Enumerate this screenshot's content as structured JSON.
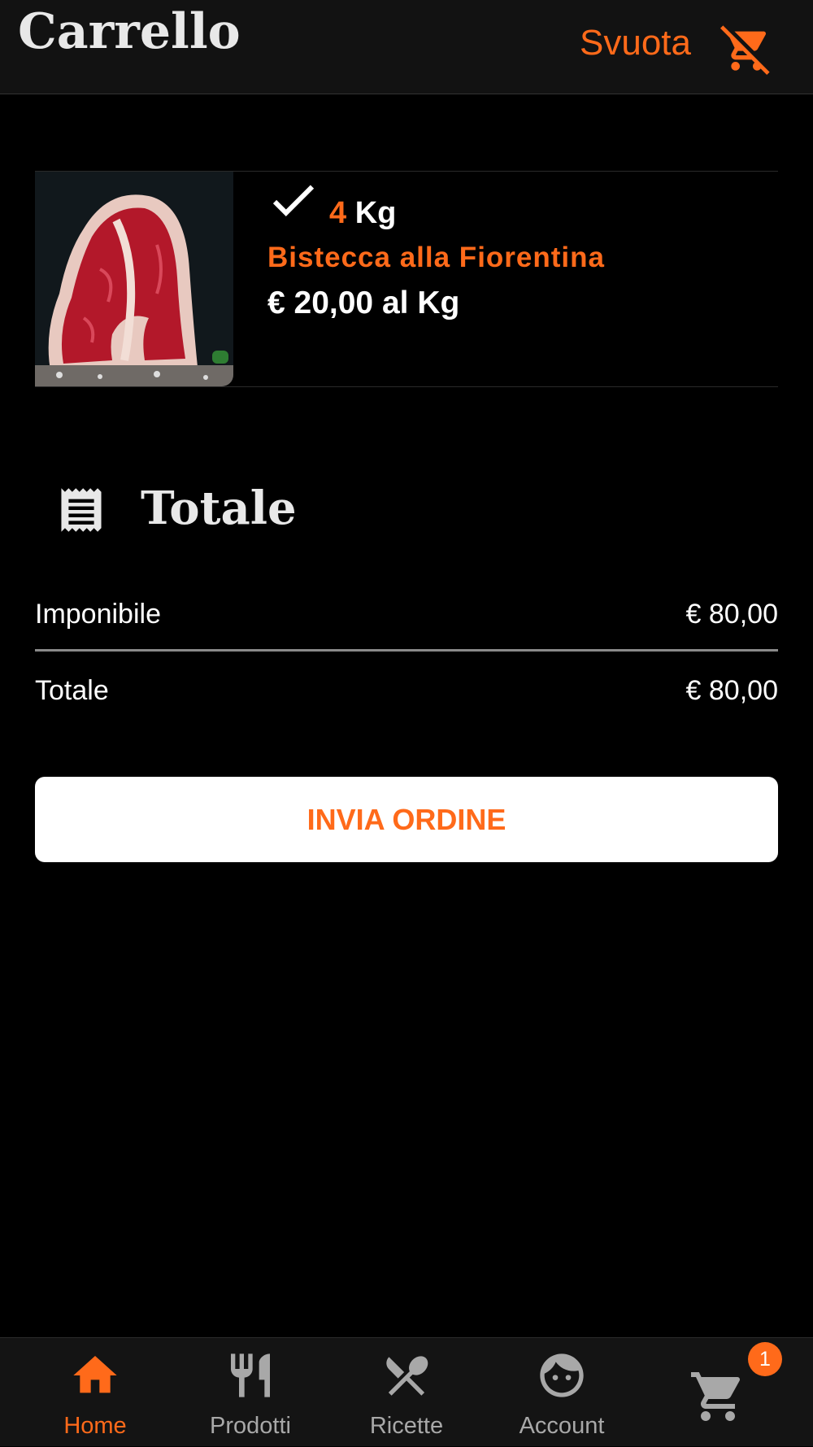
{
  "header": {
    "title": "Carrello",
    "empty_label": "Svuota"
  },
  "cart_item": {
    "quantity": "4",
    "unit": "Kg",
    "name": "Bistecca alla Fiorentina",
    "price": "€ 20,00 al Kg",
    "image_icon": "t-bone-steak-photo"
  },
  "summary": {
    "title": "Totale",
    "rows": [
      {
        "label": "Imponibile",
        "value": "€ 80,00"
      },
      {
        "label": "Totale",
        "value": "€ 80,00"
      }
    ]
  },
  "submit_label": "INVIA ORDINE",
  "nav": {
    "items": [
      {
        "label": "Home",
        "icon": "home-icon",
        "active": true
      },
      {
        "label": "Prodotti",
        "icon": "cutlery-icon"
      },
      {
        "label": "Ricette",
        "icon": "utensils-cross-icon"
      },
      {
        "label": "Account",
        "icon": "face-icon"
      },
      {
        "label": "",
        "icon": "cart-icon"
      }
    ],
    "cart_badge": "1"
  },
  "colors": {
    "accent": "#ff6a1a",
    "background": "#000000",
    "bar": "#141414"
  }
}
